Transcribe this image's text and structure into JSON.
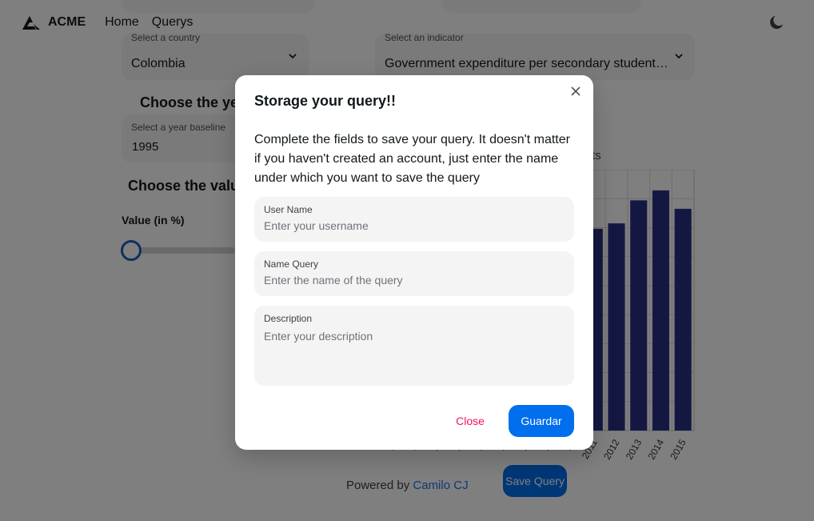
{
  "nav": {
    "brand": "ACME",
    "links": [
      "Home",
      "Querys"
    ],
    "theme_icon": "moon-icon"
  },
  "filters": {
    "country": {
      "label": "Select a country",
      "value": "Colombia"
    },
    "indicator": {
      "label": "Select an indicator",
      "value": "Government expenditure per secondary student…"
    },
    "year_section_title": "Choose the ye",
    "year": {
      "label": "Select a year baseline",
      "value": "1995"
    },
    "value_section_title": "Choose the valu",
    "value_label": "Value (in %)",
    "slider_value": 0
  },
  "chart_data": {
    "type": "bar",
    "title": "ts",
    "categories": [
      "19",
      "19",
      "20",
      "20",
      "20",
      "20",
      "20",
      "20",
      "20",
      "2011",
      "2012",
      "2013",
      "2014",
      "2015"
    ],
    "values": [
      null,
      null,
      null,
      null,
      null,
      null,
      null,
      null,
      null,
      263,
      270,
      300,
      313,
      289
    ],
    "bar_color": "#2b2f86"
  },
  "footer": {
    "powered_prefix": "Powered by ",
    "powered_link": "Camilo CJ",
    "save_query_label": "Save Query"
  },
  "modal": {
    "title": "Storage your query!!",
    "description": "Complete the fields to save your query. It doesn't matter if you haven't created an account, just enter the name under which you want to save the query",
    "fields": {
      "username": {
        "label": "User Name",
        "placeholder": "Enter your username"
      },
      "query_name": {
        "label": "Name Query",
        "placeholder": "Enter the name of the query"
      },
      "description": {
        "label": "Description",
        "placeholder": "Enter your description"
      }
    },
    "close_label": "Close",
    "save_label": "Guardar",
    "close_icon": "close-icon"
  },
  "colors": {
    "primary": "#006fee",
    "danger": "#f31260",
    "field_bg": "#f4f4f5"
  }
}
